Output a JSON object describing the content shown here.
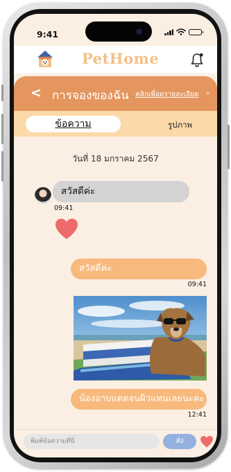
{
  "status_bar": {
    "time": "9:41"
  },
  "app": {
    "brand": "PetHome"
  },
  "header": {
    "back_glyph": "<",
    "title": "การจองของฉัน",
    "details_link": "คลิกเพื่อดูรายละเอียด",
    "details_chevron": "⌄"
  },
  "tabs": [
    {
      "label": "ข้อความ",
      "active": true
    },
    {
      "label": "รูปภาพ",
      "active": false
    }
  ],
  "chat": {
    "date": "วันที่ 18 มกราคม 2567",
    "messages": [
      {
        "side": "incoming",
        "text": "สวัสดีค่ะ",
        "time": "09:41"
      },
      {
        "side": "incoming",
        "type": "heart-reaction"
      },
      {
        "side": "outgoing",
        "text": "สวัสดีค่ะ",
        "time": "09:41"
      },
      {
        "side": "outgoing",
        "type": "photo",
        "subject": "dog wearing sunglasses on a beach lounger"
      },
      {
        "side": "outgoing",
        "text": "น้องอาบแดดจนผิวแทนเลยนะคะ",
        "time": "12:41"
      }
    ]
  },
  "composer": {
    "placeholder": "พิมพ์ข้อความที่นี่",
    "send_label": "ส่ง"
  },
  "icons": {
    "logo": "house-logo-icon",
    "notification": "bell-icon",
    "heart": "heart-icon"
  },
  "colors": {
    "header_orange": "#e4965e",
    "tab_bar": "#fbd9a8",
    "chat_bg": "#fbefe3",
    "outgoing_bubble": "#f7b97c",
    "incoming_bubble": "#d3d3d3",
    "send_button": "#95b1e0",
    "heart": "#ee6b6b",
    "brand_text": "#f2c08a"
  }
}
